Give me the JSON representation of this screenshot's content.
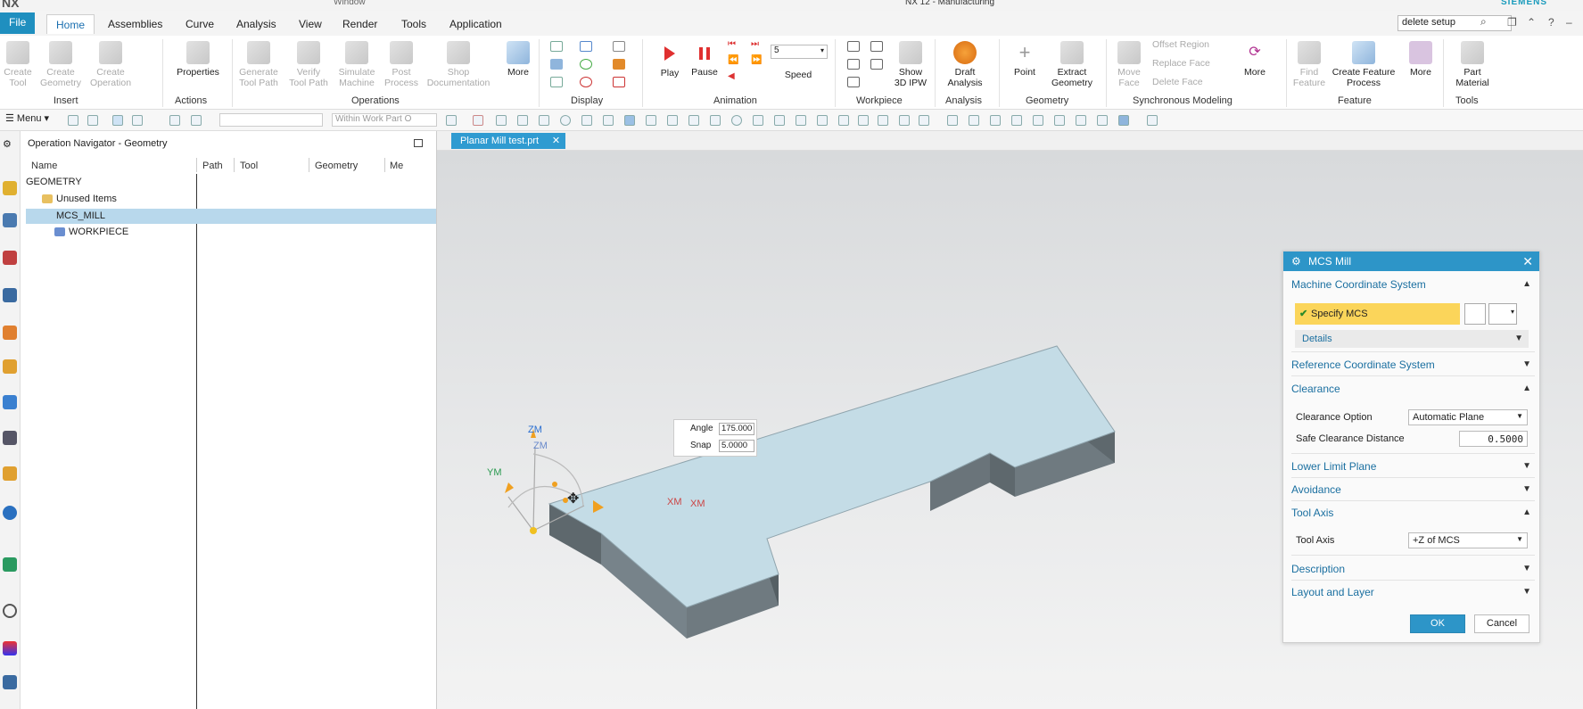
{
  "titlebar": {
    "logo": "NX",
    "title": "NX 12 - Manufacturing",
    "brand": "SIEMENS",
    "window_menu": "Window"
  },
  "tabs": [
    "File",
    "Home",
    "Assemblies",
    "Curve",
    "Analysis",
    "View",
    "Render",
    "Tools",
    "Application"
  ],
  "search": {
    "value": "delete setup"
  },
  "ribbon": {
    "insert": {
      "create_tool": "Create\nTool",
      "create_geometry": "Create\nGeometry",
      "create_operation": "Create\nOperation",
      "group": "Insert"
    },
    "actions": {
      "properties": "Properties",
      "group": "Actions"
    },
    "operations": {
      "generate": "Generate\nTool Path",
      "verify": "Verify\nTool Path",
      "simulate": "Simulate\nMachine",
      "post": "Post\nProcess",
      "shop": "Shop\nDocumentation",
      "more": "More",
      "group": "Operations"
    },
    "display": {
      "group": "Display"
    },
    "animation": {
      "play": "Play",
      "pause": "Pause",
      "speed_label": "Speed",
      "speed_value": "5",
      "group": "Animation"
    },
    "workpiece": {
      "show": "Show\n3D IPW",
      "group": "Workpiece"
    },
    "analysis": {
      "draft": "Draft\nAnalysis",
      "group": "Analysis"
    },
    "geometry": {
      "point": "Point",
      "extract": "Extract\nGeometry",
      "group": "Geometry"
    },
    "sync": {
      "move_face": "Move\nFace",
      "offset_region": "Offset Region",
      "replace_face": "Replace Face",
      "delete_face": "Delete Face",
      "more": "More",
      "group": "Synchronous Modeling"
    },
    "feature": {
      "find": "Find\nFeature",
      "create_process": "Create Feature\nProcess",
      "more": "More",
      "group": "Feature"
    },
    "tools": {
      "part_material": "Part\nMaterial",
      "group": "Tools"
    }
  },
  "toolbar2": {
    "menu": "Menu",
    "scope": "Within Work Part O"
  },
  "navigator": {
    "title": "Operation Navigator - Geometry",
    "columns": [
      "Name",
      "Path",
      "Tool",
      "Geometry",
      "Me"
    ],
    "rows": [
      "GEOMETRY",
      "Unused Items",
      "MCS_MILL",
      "WORKPIECE"
    ]
  },
  "doc_tab": {
    "label": "Planar Mill test.prt"
  },
  "viewport": {
    "angle_label": "Angle",
    "angle_value": "175.000",
    "snap_label": "Snap",
    "snap_value": "5.0000",
    "axes": {
      "zm": "ZM",
      "zm2": "ZM",
      "ym": "YM",
      "xm": "XM",
      "xm2": "XM"
    }
  },
  "dialog": {
    "title": "MCS Mill",
    "sections": {
      "mcs": "Machine Coordinate System",
      "specify_mcs": "Specify MCS",
      "details": "Details",
      "ref": "Reference Coordinate System",
      "clearance": "Clearance",
      "clearance_option_label": "Clearance Option",
      "clearance_option_value": "Automatic Plane",
      "safe_distance_label": "Safe Clearance Distance",
      "safe_distance_value": "0.5000",
      "lower_limit": "Lower Limit Plane",
      "avoidance": "Avoidance",
      "tool_axis": "Tool Axis",
      "tool_axis_label": "Tool Axis",
      "tool_axis_value": "+Z of MCS",
      "description": "Description",
      "layout": "Layout and Layer"
    },
    "ok": "OK",
    "cancel": "Cancel"
  },
  "colors": {
    "accent": "#2d95c8",
    "highlight": "#fbd55a",
    "part_top": "#c4dce6",
    "part_side": "#6f7a80"
  }
}
